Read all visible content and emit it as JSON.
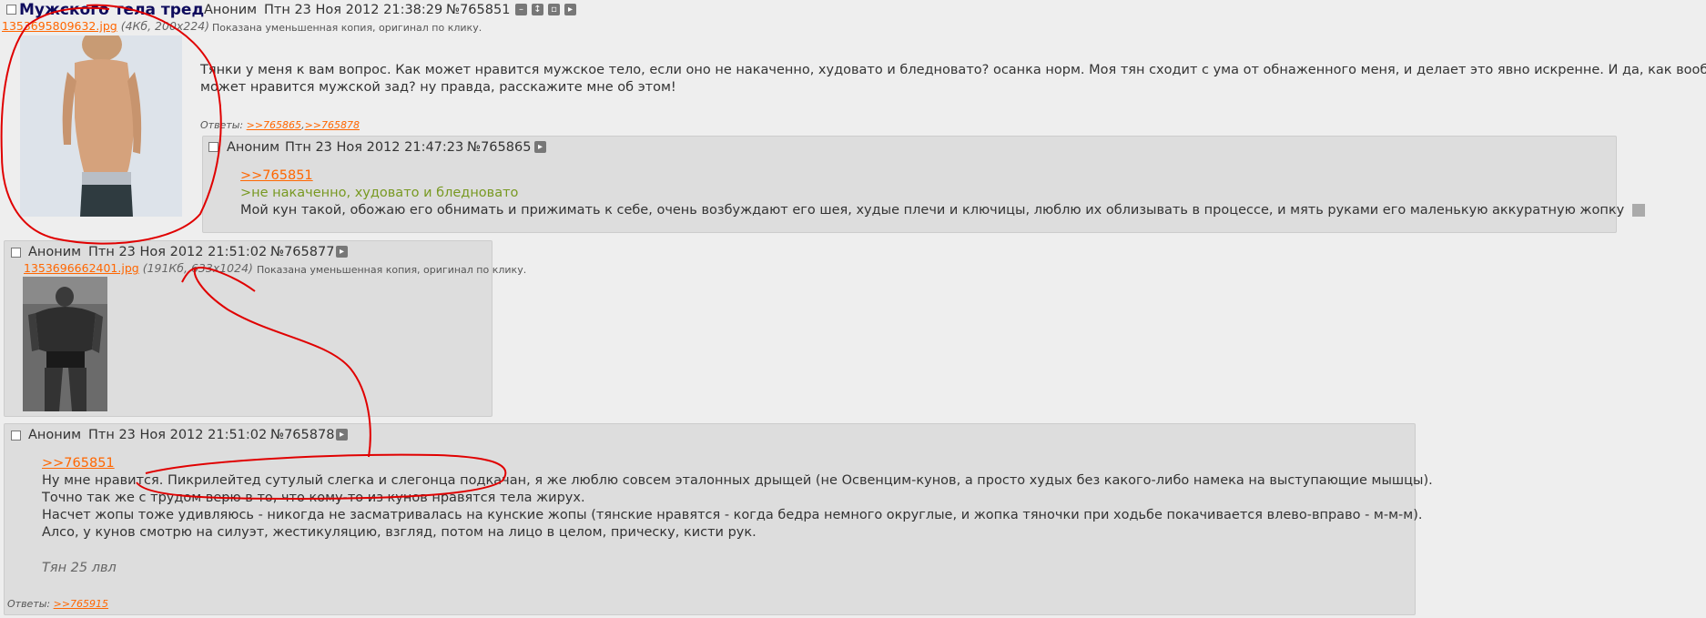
{
  "op": {
    "title": "Мужского тела тред",
    "author": "Аноним",
    "date": "Птн 23 Ноя 2012 21:38:29",
    "num": "№765851",
    "file_name": "1353695809632.jpg",
    "file_info": "(4Кб, 200x224)",
    "thumb_note": "Показана уменьшенная копия, оригинал по клику.",
    "text_line1": "Тянки у меня к вам вопрос. Как может нравится мужское тело, если оно не накаченно, худовато и бледновато? осанка норм. Моя тян сходит с ума от обнаженного меня, и делает это явно искренне. И да, как вообще",
    "text_line2": "может нравится мужской зад? ну правда, расскажите мне об этом!",
    "replies_label": "Ответы:",
    "replies": [
      ">>765865",
      ">>765878"
    ]
  },
  "post_765865": {
    "author": "Аноним",
    "date": "Птн 23 Ноя 2012 21:47:23",
    "num": "№765865",
    "ref": ">>765851",
    "greentext": ">не накаченно, худовато и бледновато",
    "text": "Мой кун такой, обожаю его обнимать и прижимать к себе, очень возбуждают его шея, худые плечи и ключицы, люблю их облизывать в процессе, и мять руками его маленькую аккуратную жопку"
  },
  "post_765877": {
    "author": "Аноним",
    "date": "Птн 23 Ноя 2012 21:51:02",
    "num": "№765877",
    "file_name": "1353696662401.jpg",
    "file_info_open": "(",
    "file_info": "191Кб, 633x1024",
    "file_info_close": ")",
    "thumb_note": "Показана уменьшенная копия, оригинал по клику."
  },
  "post_765878": {
    "author": "Аноним",
    "date": "Птн 23 Ноя 2012 21:51:02",
    "num": "№765878",
    "ref": ">>765851",
    "line1": "Ну мне нравится. Пикрилейтед сутулый слегка и слегонца подкачан, я же люблю совсем эталонных дрыщей (не Освенцим-кунов, а просто худых без какого-либо намека на выступающие мышцы).",
    "line2": "Точно так же с трудом верю в то, что кому-то из кунов нравятся тела жирух.",
    "line3": "Насчет жопы тоже удивляюсь - никогда не засматривалась на кунские жопы (тянские нравятся - когда бедра немного округлые, и жопка тяночки при ходьбе покачивается влево-вправо - м-м-м).",
    "line4": "Алсо, у кунов смотрю на силуэт, жестикуляцию, взгляд, потом на лицо в целом, прическу, кисти рук.",
    "signature": "Тян 25 лвл",
    "replies_label": "Ответы:",
    "replies": [
      ">>765915"
    ]
  },
  "colors": {
    "background": "#eeeeee",
    "reply_bg": "#dddddd",
    "link": "#ff6600",
    "greentext": "#789922",
    "title": "#0f0c5d",
    "annotation": "#e00000"
  },
  "icons": [
    "checkbox-icon",
    "minus-icon",
    "updown-icon",
    "window-icon",
    "play-icon"
  ]
}
